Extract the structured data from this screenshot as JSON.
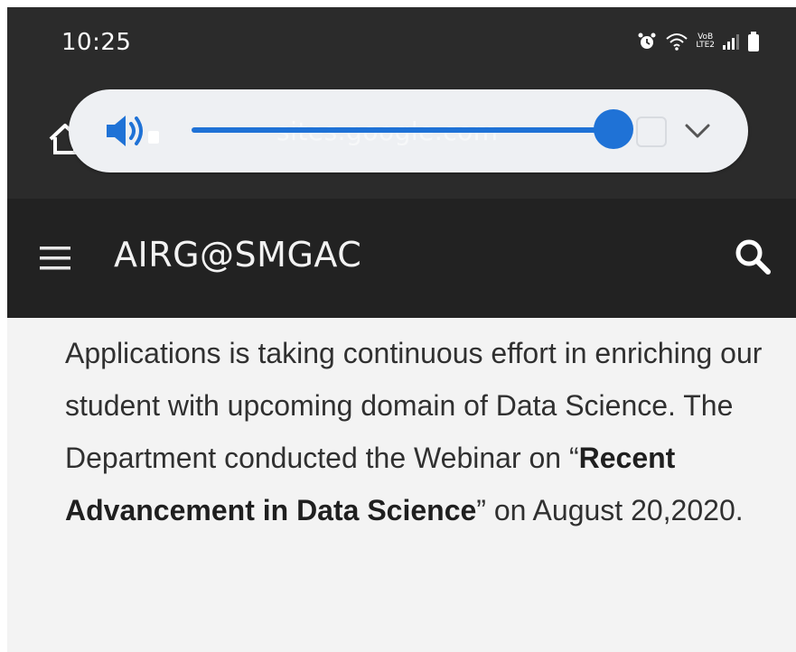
{
  "status_bar": {
    "time": "10:25",
    "network_label_top": "VoB",
    "network_label_bottom": "LTE2",
    "icons": [
      "alarm-icon",
      "wifi-icon",
      "signal-icon",
      "battery-icon"
    ]
  },
  "browser": {
    "url": "sites.google.com"
  },
  "volume": {
    "level": 0.92,
    "accent_color": "#1f72d6"
  },
  "app_bar": {
    "title": "AIRG@SMGAC"
  },
  "content": {
    "text_before": "Applications is taking continuous effort in enriching our student with upcoming domain of Data Science. The Department conducted the Webinar on “",
    "bold_text": "Recent Advancement in Data Science",
    "text_after": "” on August 20,2020."
  }
}
